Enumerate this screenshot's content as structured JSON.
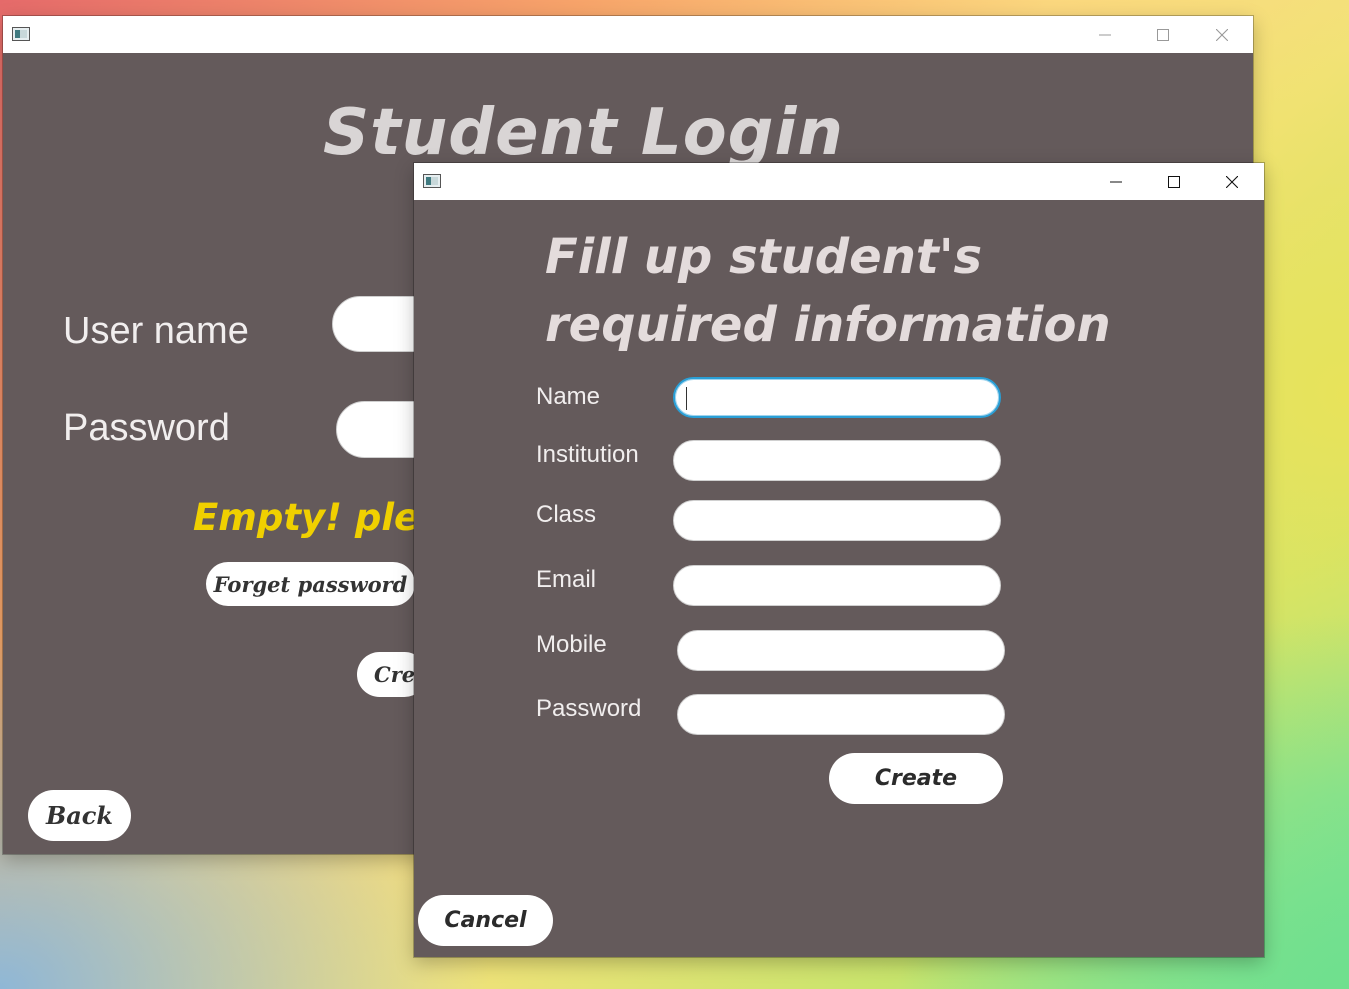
{
  "login_window": {
    "title": "Student Login",
    "username_label": "User name",
    "password_label": "Password",
    "error_message": "Empty! pleas",
    "forget_password_label": "Forget password",
    "create_label": "Cre",
    "back_label": "Back"
  },
  "form_window": {
    "title": "Fill up student's  required information",
    "fields": [
      {
        "label": "Name",
        "value": ""
      },
      {
        "label": "Institution",
        "value": ""
      },
      {
        "label": "Class",
        "value": ""
      },
      {
        "label": "Email",
        "value": ""
      },
      {
        "label": "Mobile",
        "value": ""
      },
      {
        "label": "Password",
        "value": ""
      }
    ],
    "create_label": "Create",
    "cancel_label": "Cancel"
  },
  "colors": {
    "window_bg": "#645a5b",
    "error_text": "#f0d000",
    "focus_border": "#2a9fd6"
  }
}
